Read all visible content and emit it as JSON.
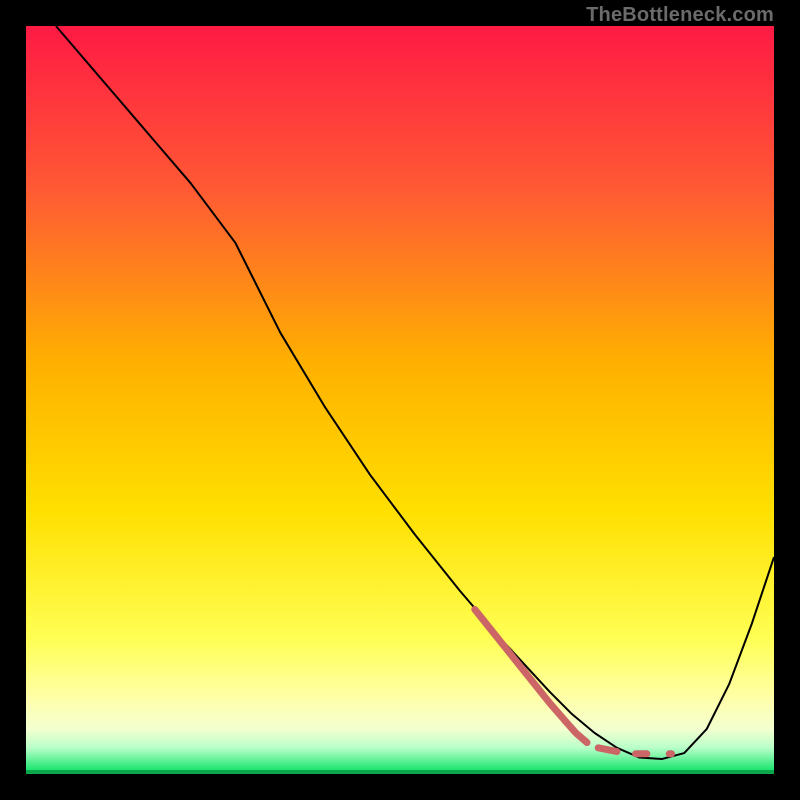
{
  "watermark": "TheBottleneck.com",
  "chart_data": {
    "type": "line",
    "title": "",
    "xlabel": "",
    "ylabel": "",
    "xlim": [
      0,
      100
    ],
    "ylim": [
      0,
      100
    ],
    "gradient": {
      "top": "#ff1a44",
      "mid_upper": "#ff7a2e",
      "mid": "#ffd400",
      "lower": "#ffff66",
      "bottom_band": "#00e060",
      "bottom_line": "#0aa84a"
    },
    "series": [
      {
        "name": "black-curve",
        "color": "#000000",
        "stroke_width": 2,
        "x": [
          4,
          10,
          16,
          22,
          28,
          34,
          40,
          46,
          52,
          58,
          64,
          70,
          73,
          76,
          79,
          82,
          85,
          88,
          91,
          94,
          97,
          100
        ],
        "y": [
          100,
          93,
          86,
          79,
          71,
          59,
          49,
          40,
          32,
          24.5,
          17.5,
          11,
          8,
          5.5,
          3.5,
          2.2,
          2.0,
          2.8,
          6,
          12,
          20,
          29
        ]
      },
      {
        "name": "red-dash-overlay",
        "color": "#cc6666",
        "stroke_width": 7,
        "linecap": "round",
        "segments": [
          {
            "x": [
              60,
              66,
              70,
              72
            ],
            "y": [
              22,
              14.5,
              9.5,
              7.2
            ]
          },
          {
            "x": [
              72,
              73.5,
              75
            ],
            "y": [
              7.2,
              5.5,
              4.2
            ]
          },
          {
            "x": [
              76.5,
              79
            ],
            "y": [
              3.5,
              3.0
            ]
          },
          {
            "x": [
              81.5,
              83
            ],
            "y": [
              2.7,
              2.7
            ]
          },
          {
            "x": [
              86,
              86.3
            ],
            "y": [
              2.7,
              2.7
            ]
          }
        ]
      }
    ]
  }
}
